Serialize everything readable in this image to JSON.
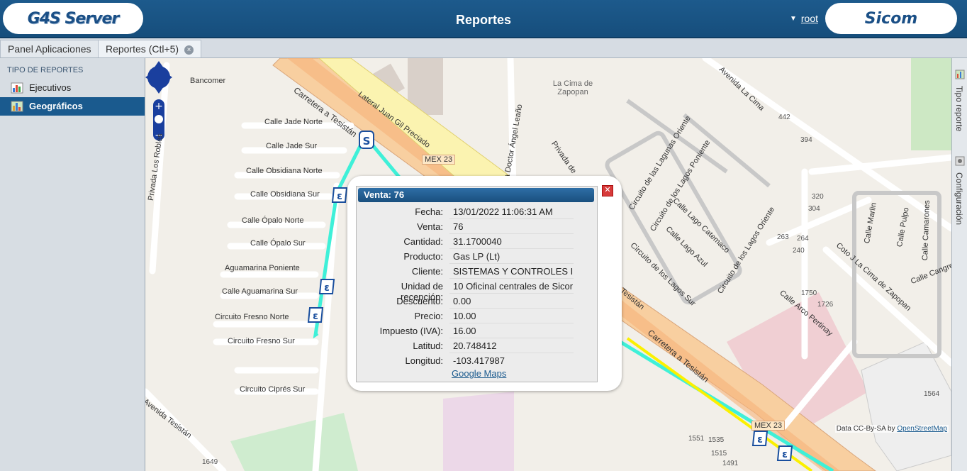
{
  "header": {
    "title": "Reportes",
    "user": "root",
    "logo_left": "G4S Server",
    "logo_right": "Sicom"
  },
  "tabs": [
    {
      "label": "Panel Aplicaciones"
    },
    {
      "label": "Reportes (Ctl+5)",
      "close": "×"
    }
  ],
  "left_panel": {
    "title": "TIPO DE REPORTES",
    "items": [
      {
        "label": "Ejecutivos"
      },
      {
        "label": "Geográficos"
      }
    ]
  },
  "right_strip": {
    "items": [
      {
        "label": "Tipo reporte"
      },
      {
        "label": "Configuración"
      }
    ]
  },
  "map": {
    "streets": [
      "Bancomer",
      "Carretera a Tesistán",
      "Lateral Juan Gil Preciado",
      "Calle Jade Norte",
      "Calle Jade Sur",
      "Calle Obsidiana Norte",
      "Calle Obsidiana Sur",
      "Calle Ópalo Norte",
      "Calle Ópalo Sur",
      "Aguamarina Poniente",
      "Calle Aguamarina Sur",
      "Circuito Fresno Norte",
      "Circuito Fresno Sur",
      "Circuito Ciprés Sur",
      "Avenida Tesistán",
      "Privada Los Robles",
      "MEX 23",
      "da Doctor Ángel Leaño",
      "La Cima de Zapopan",
      "Privada de",
      "Circuito de las Lagunas Oriente",
      "Circuito de los Lagos Poniente",
      "Calle Lago Catemaco",
      "Calle Lago Azul",
      "Circuito de los Lagos Oriente",
      "Circuito de los Lagos Sur",
      "Avenida La Cima",
      "Calle Arco Pertinay",
      "Coto J La Cima de Zapopan",
      "Calle Marlin",
      "Calle Pulpo",
      "Calle Camarones",
      "Calle Cangrejo",
      "Tesistán",
      "Carretera a Tesistán"
    ],
    "numbers": [
      "442",
      "394",
      "320",
      "304",
      "263",
      "264",
      "240",
      "1750",
      "1726",
      "1564",
      "1551",
      "1535",
      "1515",
      "1491",
      "1649"
    ],
    "attribution": "Data CC-By-SA by",
    "attribution_link": "OpenStreetMap"
  },
  "popup": {
    "title": "Venta: 76",
    "rows": [
      {
        "k": "Fecha:",
        "v": "13/01/2022 11:06:31 AM"
      },
      {
        "k": "Venta:",
        "v": "76"
      },
      {
        "k": "Cantidad:",
        "v": "31.1700040"
      },
      {
        "k": "Producto:",
        "v": "Gas LP (Lt)"
      },
      {
        "k": "Cliente:",
        "v": "SISTEMAS Y CONTROLES I"
      },
      {
        "k": "Unidad de recepción:",
        "v": "10 Oficinal centrales de Sicor"
      },
      {
        "k": "Descuento:",
        "v": "0.00"
      },
      {
        "k": "Precio:",
        "v": "10.00"
      },
      {
        "k": "Impuesto (IVA):",
        "v": "16.00"
      },
      {
        "k": "Latitud:",
        "v": "20.748412"
      },
      {
        "k": "Longitud:",
        "v": "-103.417987"
      }
    ],
    "link": "Google Maps"
  }
}
